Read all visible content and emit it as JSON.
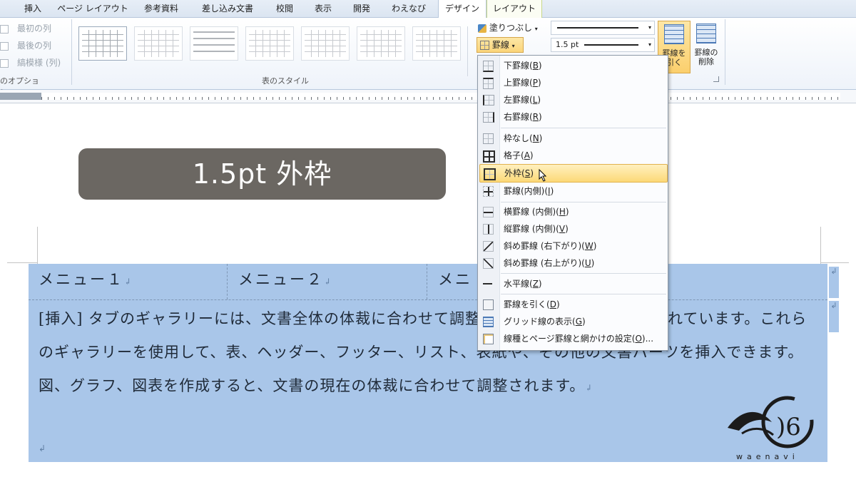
{
  "tabs": [
    {
      "label": "挿入"
    },
    {
      "label": "ページ レイアウト"
    },
    {
      "label": "参考資料"
    },
    {
      "label": "差し込み文書"
    },
    {
      "label": "校閲"
    },
    {
      "label": "表示"
    },
    {
      "label": "開発"
    },
    {
      "label": "わえなび"
    },
    {
      "label": "デザイン"
    },
    {
      "label": "レイアウト"
    }
  ],
  "ribbon": {
    "options": [
      {
        "label": "最初の列"
      },
      {
        "label": "最後の列"
      },
      {
        "label": "縞模様 (列)"
      }
    ],
    "options_group_label": "のオプション",
    "styles_group_label": "表のスタイル",
    "shading_label": "塗りつぶし",
    "borders_label": "罫線",
    "line_weight": "1.5 pt",
    "draw_table_label_1": "罫線を",
    "draw_table_label_2": "引く",
    "eraser_label_1": "罫線の",
    "eraser_label_2": "削除"
  },
  "caption": "1.5pt  外枠",
  "table": {
    "menu1": "メニュー１",
    "menu2": "メニュー２",
    "menu3": "メニ",
    "body": "[挿入] タブのギャラリーには、文書全体の体裁に合わせて調整するためのアイテムが含まれています。これらのギャラリーを使用して、表、ヘッダー、フッター、リスト、表紙や、その他の文書パーツを挿入できます。図、グラフ、図表を作成すると、文書の現在の体裁に合わせて調整されます。"
  },
  "menu": {
    "items": [
      {
        "label": "下罫線(",
        "key": "B",
        "icon": "bottom-border-icon"
      },
      {
        "label": "上罫線(",
        "key": "P",
        "icon": "top-border-icon"
      },
      {
        "label": "左罫線(",
        "key": "L",
        "icon": "left-border-icon"
      },
      {
        "label": "右罫線(",
        "key": "R",
        "icon": "right-border-icon"
      },
      {
        "label": "枠なし(",
        "key": "N",
        "icon": "no-border-icon"
      },
      {
        "label": "格子(",
        "key": "A",
        "icon": "all-borders-icon"
      },
      {
        "label": "外枠(",
        "key": "S",
        "icon": "outside-borders-icon"
      },
      {
        "label": "罫線(内側)(",
        "key": "I",
        "icon": "inside-borders-icon"
      },
      {
        "label": "横罫線 (内側)(",
        "key": "H",
        "icon": "inside-horizontal-border-icon"
      },
      {
        "label": "縦罫線 (内側)(",
        "key": "V",
        "icon": "inside-vertical-border-icon"
      },
      {
        "label": "斜め罫線 (右下がり)(",
        "key": "W",
        "icon": "diagonal-down-border-icon"
      },
      {
        "label": "斜め罫線 (右上がり)(",
        "key": "U",
        "icon": "diagonal-up-border-icon"
      },
      {
        "label": "水平線(",
        "key": "Z",
        "icon": "horizontal-line-icon"
      },
      {
        "label": "罫線を引く(",
        "key": "D",
        "icon": "draw-table-icon"
      },
      {
        "label": "グリッド線の表示(",
        "key": "G",
        "icon": "view-gridlines-icon"
      },
      {
        "label": "線種とページ罫線と網かけの設定(",
        "key": "O",
        "suffix": ")...",
        "icon": "borders-and-shading-icon"
      }
    ],
    "close": ")"
  },
  "watermark": "waenavi"
}
